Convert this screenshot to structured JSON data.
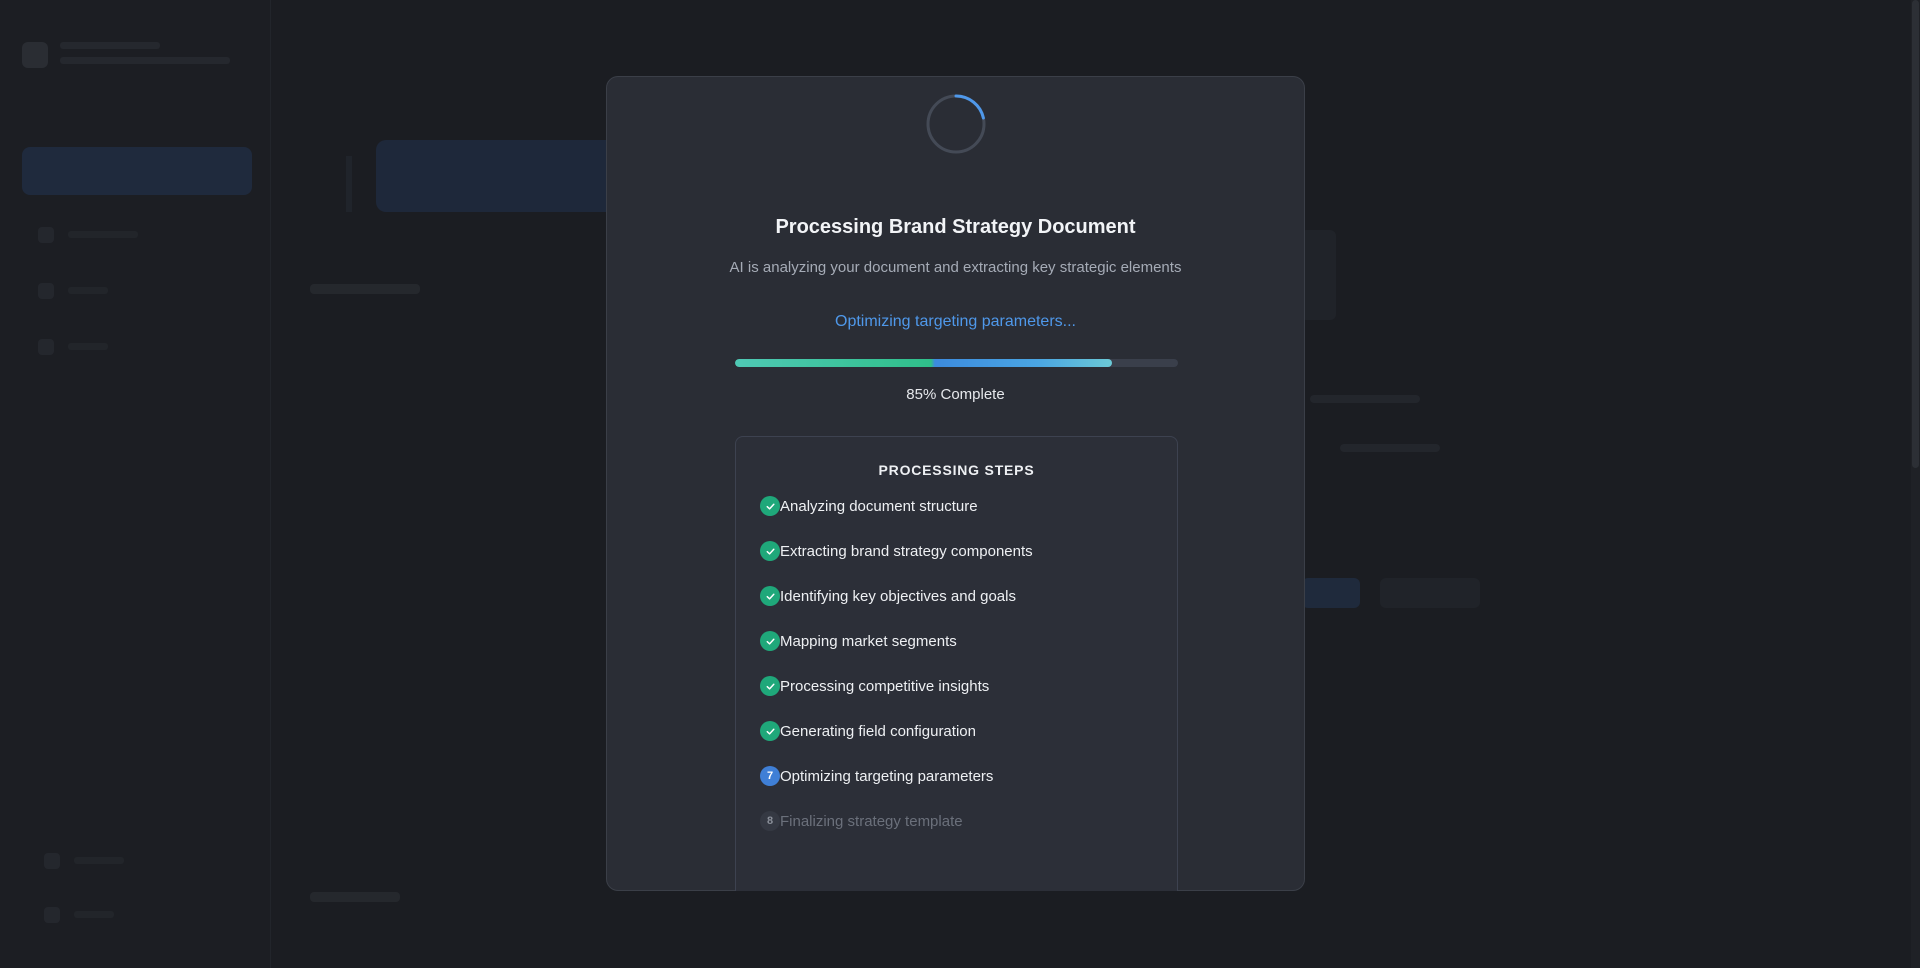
{
  "modal": {
    "title": "Processing Brand Strategy Document",
    "subtitle": "AI is analyzing your document and extracting key strategic elements",
    "status_text": "Optimizing targeting parameters...",
    "progress_percent": 85,
    "progress_label": "85% Complete",
    "steps_heading": "PROCESSING STEPS",
    "steps": [
      {
        "label": "Analyzing document structure",
        "state": "done",
        "badge": ""
      },
      {
        "label": "Extracting brand strategy components",
        "state": "done",
        "badge": ""
      },
      {
        "label": "Identifying key objectives and goals",
        "state": "done",
        "badge": ""
      },
      {
        "label": "Mapping market segments",
        "state": "done",
        "badge": ""
      },
      {
        "label": "Processing competitive insights",
        "state": "done",
        "badge": ""
      },
      {
        "label": "Generating field configuration",
        "state": "done",
        "badge": ""
      },
      {
        "label": "Optimizing targeting parameters",
        "state": "active",
        "badge": "7"
      },
      {
        "label": "Finalizing strategy template",
        "state": "pending",
        "badge": "8"
      }
    ]
  },
  "colors": {
    "accent": "#4f98ea",
    "success": "#1fa87a",
    "background": "#1b1d22",
    "modal": "#2a2d35"
  },
  "icons": {
    "spinner": "loading-spinner-icon",
    "done": "check-icon"
  }
}
